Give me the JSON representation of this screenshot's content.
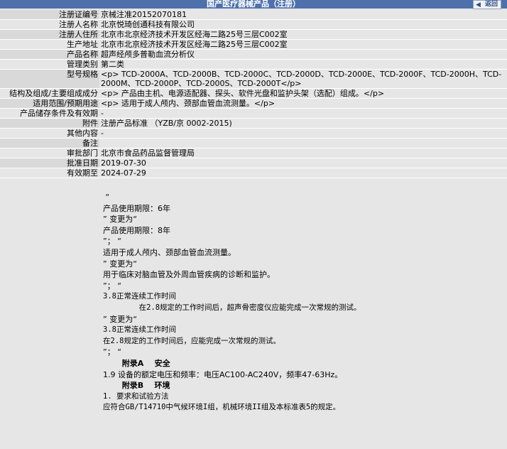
{
  "header": {
    "title": "国产医疗器械产品（注册）",
    "back_label": "返回"
  },
  "fields": [
    {
      "label": "注册证编号",
      "value": "京械注准20152070181"
    },
    {
      "label": "注册人名称",
      "value": "北京悦琦创通科技有限公司"
    },
    {
      "label": "注册人住所",
      "value": "北京市北京经济技术开发区经海二路25号三层C002室"
    },
    {
      "label": "生产地址",
      "value": "北京市北京经济技术开发区经海二路25号三层C002室"
    },
    {
      "label": "产品名称",
      "value": "超声经颅多普勒血流分析仪"
    },
    {
      "label": "管理类别",
      "value": "第二类"
    },
    {
      "label": "型号规格",
      "value": "<p> TCD-2000A、TCD-2000B、TCD-2000C、TCD-2000D、TCD-2000E、TCD-2000F、TCD-2000H、TCD-2000M、TCD-2000P、TCD-2000S、TCD-2000T</p>"
    },
    {
      "label": "结构及组成/主要组成成分",
      "value": "<p> 产品由主机、电源适配器、探头、软件光盘和监护头架（选配）组成。</p>"
    },
    {
      "label": "适用范围/预期用途",
      "value": "<p> 适用于成人颅内、颈部血管血流测量。</p>"
    },
    {
      "label": "产品储存条件及有效期",
      "value": "-"
    },
    {
      "label": "附件",
      "value": "注册产品标准 （YZB/京 0002-2015)"
    },
    {
      "label": "其他内容",
      "value": "-"
    },
    {
      "label": "备注",
      "value": ""
    },
    {
      "label": "审批部门",
      "value": "北京市食品药品监督管理局"
    },
    {
      "label": "批准日期",
      "value": "2019-07-30"
    },
    {
      "label": "有效期至",
      "value": "2024-07-29"
    }
  ],
  "change_notes": [
    {
      "text": " “",
      "style": ""
    },
    {
      "text": "产品使用期限：6年",
      "style": ""
    },
    {
      "text": "” 变更为“",
      "style": ""
    },
    {
      "text": "产品使用期限：8年",
      "style": ""
    },
    {
      "text": "”； “",
      "style": ""
    },
    {
      "text": "适用于成人颅内、颈部血管血流测量。",
      "style": ""
    },
    {
      "text": "” 变更为“",
      "style": ""
    },
    {
      "text": "用于临床对脑血管及外周血管疾病的诊断和监护。",
      "style": ""
    },
    {
      "text": "”； “",
      "style": ""
    },
    {
      "text": "3.8正常连续工作时间",
      "style": "mono"
    },
    {
      "text": "        在2.8规定的工作时间后，超声骨密度仪应能完成一次常规的测试。",
      "style": "mono"
    },
    {
      "text": "” 变更为“",
      "style": ""
    },
    {
      "text": "3.8正常连续工作时间",
      "style": "mono"
    },
    {
      "text": "在2.8规定的工作时间后，应能完成一次常规的测试。",
      "style": "mono"
    },
    {
      "text": "”； “",
      "style": ""
    },
    {
      "text": "       附录A    安全",
      "style": "heading"
    },
    {
      "text": "1.9 设备的额定电压和频率：电压AC100-AC240V，频率47-63Hz。",
      "style": ""
    },
    {
      "text": "       附录B    环境",
      "style": "heading"
    },
    {
      "text": "1. 要求和试验方法",
      "style": "mono"
    },
    {
      "text": "应符合GB/T14710中气候环境I组，机械环境II组及本标准表5的规定。",
      "style": "mono"
    }
  ]
}
